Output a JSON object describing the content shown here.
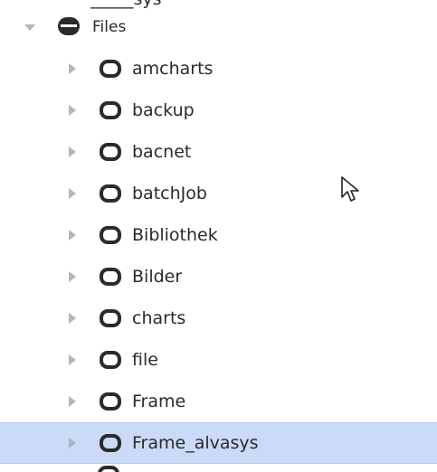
{
  "header_fragment": "_____sys",
  "root": {
    "label": "Files",
    "expanded": true,
    "icon": "drive-icon"
  },
  "children": [
    {
      "label": "amcharts",
      "icon": "folder-icon",
      "selected": false
    },
    {
      "label": "backup",
      "icon": "folder-icon",
      "selected": false
    },
    {
      "label": "bacnet",
      "icon": "folder-icon",
      "selected": false
    },
    {
      "label": "batchJob",
      "icon": "folder-icon",
      "selected": false
    },
    {
      "label": "Bibliothek",
      "icon": "folder-icon",
      "selected": false
    },
    {
      "label": "Bilder",
      "icon": "folder-icon",
      "selected": false
    },
    {
      "label": "charts",
      "icon": "folder-icon",
      "selected": false
    },
    {
      "label": "file",
      "icon": "folder-icon",
      "selected": false
    },
    {
      "label": "Frame",
      "icon": "folder-icon",
      "selected": false
    },
    {
      "label": "Frame_alvasys",
      "icon": "folder-icon",
      "selected": true
    }
  ],
  "colors": {
    "selection_background": "#cbdaf7",
    "icon_fill": "#2b2b2b",
    "toggle_fill": "#b5b5b5"
  }
}
